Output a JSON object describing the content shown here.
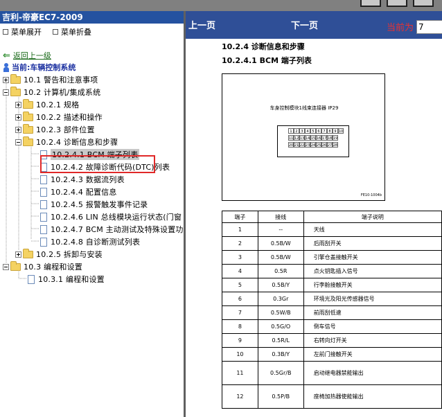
{
  "window": {
    "title": "吉利-帝豪EC7-2009"
  },
  "menu": {
    "expand_label": "菜单展开",
    "collapse_label": "菜单折叠"
  },
  "tree": {
    "back_label": "返回上一级",
    "current_label": "当前:车辆控制系统",
    "nodes": [
      {
        "label": "10.1 警告和注意事项"
      },
      {
        "label": "10.2 计算机/集成系统"
      },
      {
        "label": "10.2.1 规格"
      },
      {
        "label": "10.2.2 描述和操作"
      },
      {
        "label": "10.2.3 部件位置"
      },
      {
        "label": "10.2.4 诊断信息和步骤"
      },
      {
        "label": "10.2.4.1 BCM 端子列表"
      },
      {
        "label": "10.2.4.2 故障诊断代码(DTC)列表"
      },
      {
        "label": "10.2.4.3 数据流列表"
      },
      {
        "label": "10.2.4.4 配置信息"
      },
      {
        "label": "10.2.4.5 报警触发事件记录"
      },
      {
        "label": "10.2.4.6 LIN 总线模块运行状态(门窗"
      },
      {
        "label": "10.2.4.7 BCM 主动测试及特殊设置功"
      },
      {
        "label": "10.2.4.8 自诊断测试列表"
      },
      {
        "label": "10.2.5 拆卸与安装"
      },
      {
        "label": "10.3 编程和设置"
      },
      {
        "label": "10.3.1 编程和设置"
      }
    ]
  },
  "nav": {
    "prev_label": "上一页",
    "next_label": "下一页",
    "current_page_label": "当前为",
    "current_page_value": "7"
  },
  "content": {
    "heading": "10.2.4 诊断信息和步骤",
    "subheading": "10.2.4.1 BCM 端子列表",
    "figure_caption": "车身控制模块1线束连接器 IP29",
    "figure_code": "FE10-1004b",
    "connector_top_row": [
      "1",
      "2",
      "3",
      "4",
      "5",
      "6",
      "7",
      "8",
      "9",
      "10"
    ],
    "connector_mid_row": [
      "11",
      "12",
      "13",
      "14",
      "15",
      "16",
      "17",
      "18",
      "19"
    ],
    "connector_bot_row": [
      "20",
      "21",
      "22",
      "23",
      "24",
      "25",
      "26",
      "27",
      "28"
    ],
    "table": {
      "headers": [
        "端子",
        "接线",
        "端子说明"
      ],
      "rows": [
        [
          "1",
          "--",
          "天线"
        ],
        [
          "2",
          "0.5B/W",
          "后雨刮开关"
        ],
        [
          "3",
          "0.5B/W",
          "引擎仓盖接触开关"
        ],
        [
          "4",
          "0.5R",
          "点火钥匙插入信号"
        ],
        [
          "5",
          "0.5B/Y",
          "行李舱接触开关"
        ],
        [
          "6",
          "0.3Gr",
          "环境光及阳光传感器信号"
        ],
        [
          "7",
          "0.5W/B",
          "前雨刮低速"
        ],
        [
          "8",
          "0.5G/O",
          "倒车信号"
        ],
        [
          "9",
          "0.5R/L",
          "右转向灯开关"
        ],
        [
          "10",
          "0.3B/Y",
          "左前门接触开关"
        ],
        [
          "11",
          "0.5Gr/B",
          "启动继电器禁能输出"
        ],
        [
          "12",
          "0.5P/B",
          "座椅加热器使能输出"
        ]
      ]
    }
  }
}
